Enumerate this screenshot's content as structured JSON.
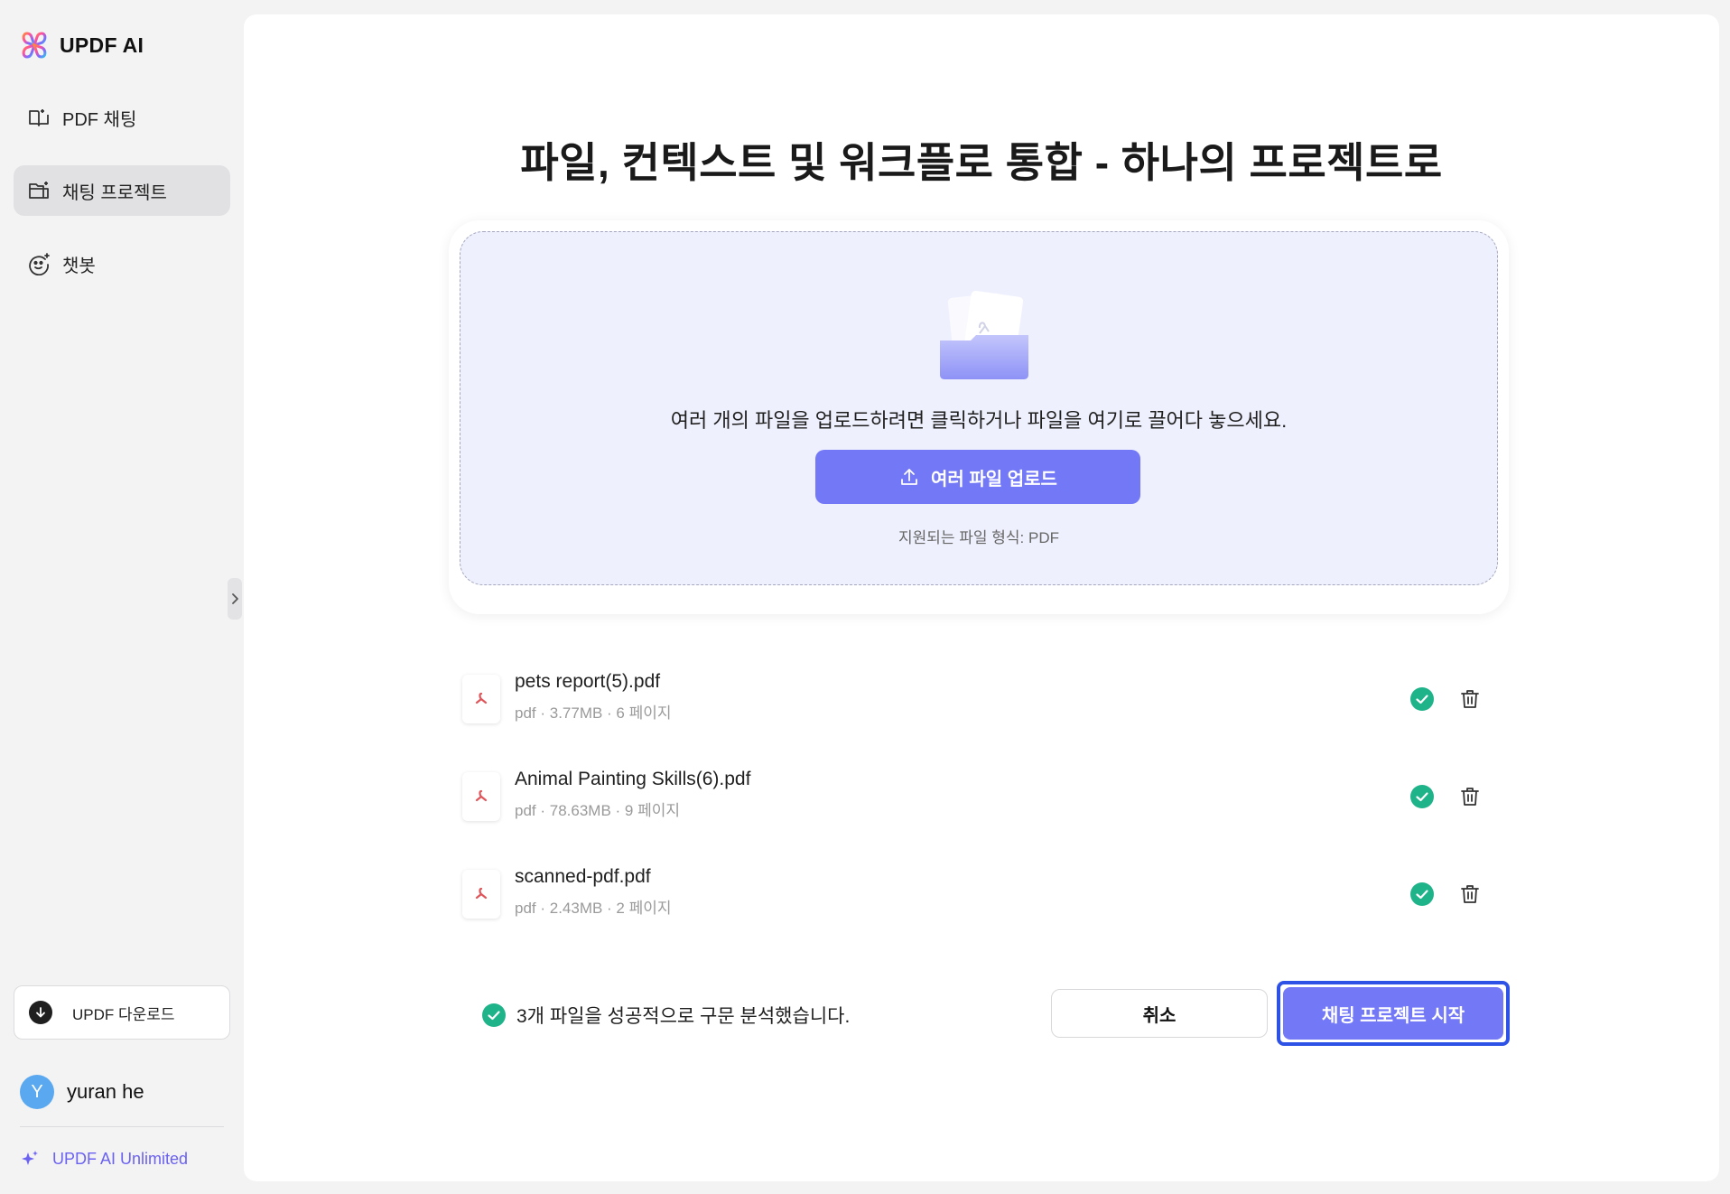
{
  "app": {
    "name": "UPDF AI"
  },
  "sidebar": {
    "items": [
      {
        "label": "PDF 채팅",
        "icon": "book-icon",
        "active": false
      },
      {
        "label": "채팅 프로젝트",
        "icon": "folder-icon",
        "active": true
      },
      {
        "label": "챗봇",
        "icon": "bot-icon",
        "active": false
      }
    ],
    "download_label": "UPDF 다운로드",
    "user": {
      "initial": "Y",
      "name": "yuran he"
    },
    "plan_label": "UPDF AI Unlimited"
  },
  "main": {
    "title": "파일, 컨텍스트 및 워크플로 통합 - 하나의 프로젝트로",
    "dropzone": {
      "instruction": "여러 개의 파일을 업로드하려면 클릭하거나 파일을 여기로 끌어다 놓으세요.",
      "upload_label": "여러 파일 업로드",
      "formats": "지원되는 파일 형식: PDF"
    },
    "files": [
      {
        "name": "pets report(5).pdf",
        "meta": "pdf · 3.77MB · 6 페이지"
      },
      {
        "name": "Animal Painting Skills(6).pdf",
        "meta": "pdf · 78.63MB · 9 페이지"
      },
      {
        "name": "scanned-pdf.pdf",
        "meta": "pdf · 2.43MB · 2 페이지"
      }
    ],
    "status": "3개 파일을 성공적으로 구문 분석했습니다.",
    "cancel_label": "취소",
    "start_label": "채팅 프로젝트 시작"
  },
  "colors": {
    "accent": "#7378f7",
    "success": "#1fb38a",
    "pdf_red": "#e0555a",
    "focus": "#2f52e6"
  }
}
